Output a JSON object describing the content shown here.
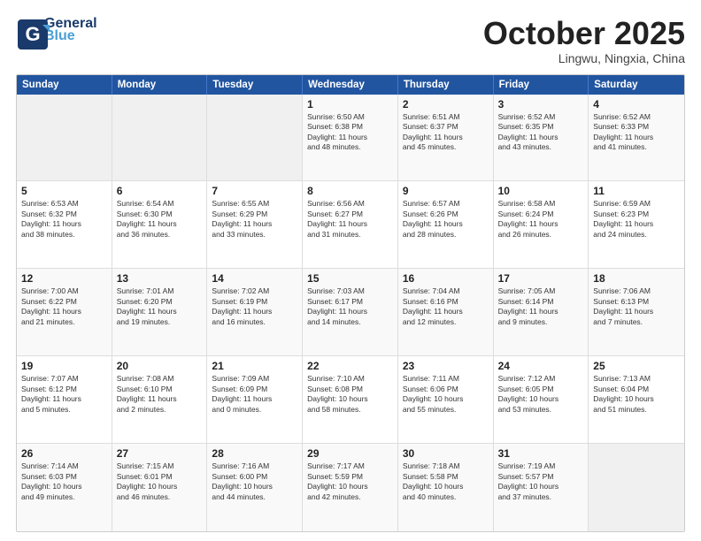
{
  "header": {
    "logo_line1": "General",
    "logo_line2": "Blue",
    "month": "October 2025",
    "location": "Lingwu, Ningxia, China"
  },
  "days_of_week": [
    "Sunday",
    "Monday",
    "Tuesday",
    "Wednesday",
    "Thursday",
    "Friday",
    "Saturday"
  ],
  "weeks": [
    [
      {
        "day": "",
        "info": ""
      },
      {
        "day": "",
        "info": ""
      },
      {
        "day": "",
        "info": ""
      },
      {
        "day": "1",
        "info": "Sunrise: 6:50 AM\nSunset: 6:38 PM\nDaylight: 11 hours\nand 48 minutes."
      },
      {
        "day": "2",
        "info": "Sunrise: 6:51 AM\nSunset: 6:37 PM\nDaylight: 11 hours\nand 45 minutes."
      },
      {
        "day": "3",
        "info": "Sunrise: 6:52 AM\nSunset: 6:35 PM\nDaylight: 11 hours\nand 43 minutes."
      },
      {
        "day": "4",
        "info": "Sunrise: 6:52 AM\nSunset: 6:33 PM\nDaylight: 11 hours\nand 41 minutes."
      }
    ],
    [
      {
        "day": "5",
        "info": "Sunrise: 6:53 AM\nSunset: 6:32 PM\nDaylight: 11 hours\nand 38 minutes."
      },
      {
        "day": "6",
        "info": "Sunrise: 6:54 AM\nSunset: 6:30 PM\nDaylight: 11 hours\nand 36 minutes."
      },
      {
        "day": "7",
        "info": "Sunrise: 6:55 AM\nSunset: 6:29 PM\nDaylight: 11 hours\nand 33 minutes."
      },
      {
        "day": "8",
        "info": "Sunrise: 6:56 AM\nSunset: 6:27 PM\nDaylight: 11 hours\nand 31 minutes."
      },
      {
        "day": "9",
        "info": "Sunrise: 6:57 AM\nSunset: 6:26 PM\nDaylight: 11 hours\nand 28 minutes."
      },
      {
        "day": "10",
        "info": "Sunrise: 6:58 AM\nSunset: 6:24 PM\nDaylight: 11 hours\nand 26 minutes."
      },
      {
        "day": "11",
        "info": "Sunrise: 6:59 AM\nSunset: 6:23 PM\nDaylight: 11 hours\nand 24 minutes."
      }
    ],
    [
      {
        "day": "12",
        "info": "Sunrise: 7:00 AM\nSunset: 6:22 PM\nDaylight: 11 hours\nand 21 minutes."
      },
      {
        "day": "13",
        "info": "Sunrise: 7:01 AM\nSunset: 6:20 PM\nDaylight: 11 hours\nand 19 minutes."
      },
      {
        "day": "14",
        "info": "Sunrise: 7:02 AM\nSunset: 6:19 PM\nDaylight: 11 hours\nand 16 minutes."
      },
      {
        "day": "15",
        "info": "Sunrise: 7:03 AM\nSunset: 6:17 PM\nDaylight: 11 hours\nand 14 minutes."
      },
      {
        "day": "16",
        "info": "Sunrise: 7:04 AM\nSunset: 6:16 PM\nDaylight: 11 hours\nand 12 minutes."
      },
      {
        "day": "17",
        "info": "Sunrise: 7:05 AM\nSunset: 6:14 PM\nDaylight: 11 hours\nand 9 minutes."
      },
      {
        "day": "18",
        "info": "Sunrise: 7:06 AM\nSunset: 6:13 PM\nDaylight: 11 hours\nand 7 minutes."
      }
    ],
    [
      {
        "day": "19",
        "info": "Sunrise: 7:07 AM\nSunset: 6:12 PM\nDaylight: 11 hours\nand 5 minutes."
      },
      {
        "day": "20",
        "info": "Sunrise: 7:08 AM\nSunset: 6:10 PM\nDaylight: 11 hours\nand 2 minutes."
      },
      {
        "day": "21",
        "info": "Sunrise: 7:09 AM\nSunset: 6:09 PM\nDaylight: 11 hours\nand 0 minutes."
      },
      {
        "day": "22",
        "info": "Sunrise: 7:10 AM\nSunset: 6:08 PM\nDaylight: 10 hours\nand 58 minutes."
      },
      {
        "day": "23",
        "info": "Sunrise: 7:11 AM\nSunset: 6:06 PM\nDaylight: 10 hours\nand 55 minutes."
      },
      {
        "day": "24",
        "info": "Sunrise: 7:12 AM\nSunset: 6:05 PM\nDaylight: 10 hours\nand 53 minutes."
      },
      {
        "day": "25",
        "info": "Sunrise: 7:13 AM\nSunset: 6:04 PM\nDaylight: 10 hours\nand 51 minutes."
      }
    ],
    [
      {
        "day": "26",
        "info": "Sunrise: 7:14 AM\nSunset: 6:03 PM\nDaylight: 10 hours\nand 49 minutes."
      },
      {
        "day": "27",
        "info": "Sunrise: 7:15 AM\nSunset: 6:01 PM\nDaylight: 10 hours\nand 46 minutes."
      },
      {
        "day": "28",
        "info": "Sunrise: 7:16 AM\nSunset: 6:00 PM\nDaylight: 10 hours\nand 44 minutes."
      },
      {
        "day": "29",
        "info": "Sunrise: 7:17 AM\nSunset: 5:59 PM\nDaylight: 10 hours\nand 42 minutes."
      },
      {
        "day": "30",
        "info": "Sunrise: 7:18 AM\nSunset: 5:58 PM\nDaylight: 10 hours\nand 40 minutes."
      },
      {
        "day": "31",
        "info": "Sunrise: 7:19 AM\nSunset: 5:57 PM\nDaylight: 10 hours\nand 37 minutes."
      },
      {
        "day": "",
        "info": ""
      }
    ]
  ]
}
